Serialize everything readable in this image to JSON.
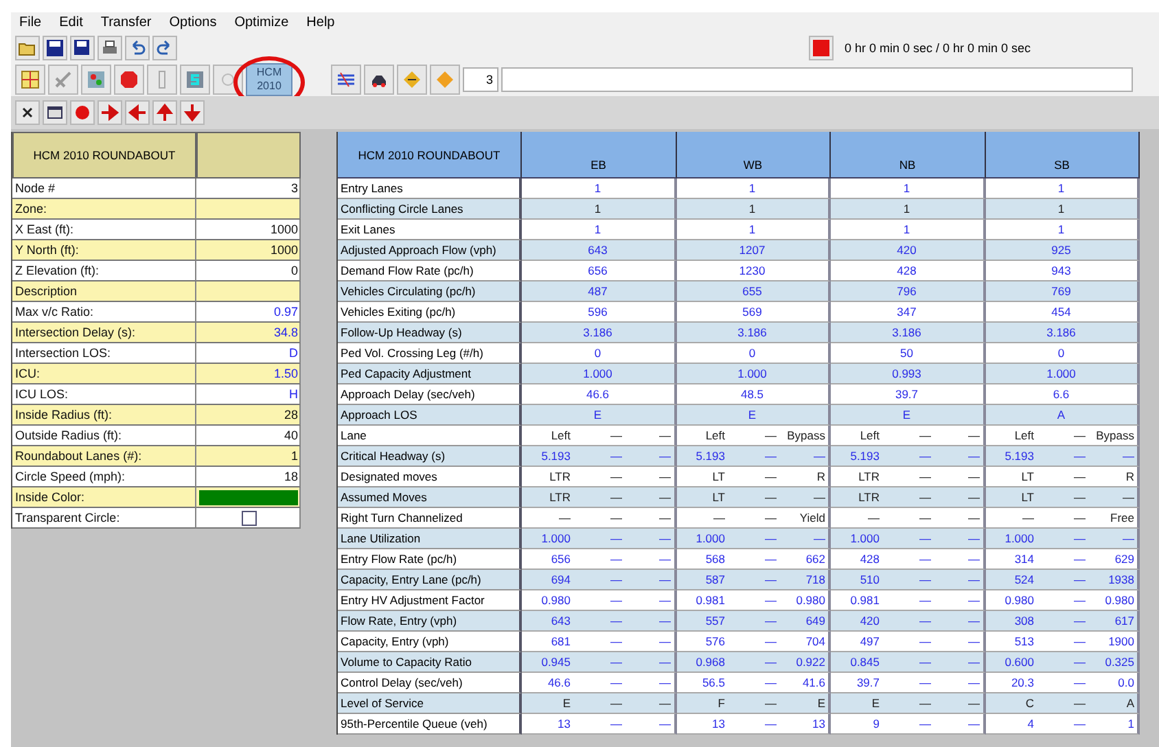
{
  "menu": [
    "File",
    "Edit",
    "Transfer",
    "Options",
    "Optimize",
    "Help"
  ],
  "toolbar": {
    "timer": "0 hr 0 min 0 sec /  0 hr 0 min 0 sec",
    "hcm_button": [
      "HCM",
      "2010"
    ],
    "node_field": "3"
  },
  "node_panel": {
    "title": "HCM 2010 ROUNDABOUT",
    "rows": [
      {
        "label": "Node #",
        "kind": "input",
        "value": "3"
      },
      {
        "label": "Zone:",
        "kind": "input"
      },
      {
        "label": "X East (ft):",
        "kind": "input",
        "value": "1000"
      },
      {
        "label": "Y North (ft):",
        "kind": "input",
        "value": "1000"
      },
      {
        "label": "Z Elevation (ft):",
        "kind": "input",
        "value": "0"
      },
      {
        "label": "Description",
        "kind": "input"
      },
      {
        "label": "Max v/c Ratio:",
        "kind": "output",
        "value": "0.97"
      },
      {
        "label": "Intersection Delay (s):",
        "kind": "output",
        "value": "34.8"
      },
      {
        "label": "Intersection LOS:",
        "kind": "output",
        "value": "D"
      },
      {
        "label": "ICU:",
        "kind": "output",
        "value": "1.50"
      },
      {
        "label": "ICU LOS:",
        "kind": "output",
        "value": "H"
      },
      {
        "label": "Inside Radius (ft):",
        "kind": "input",
        "value": "28"
      },
      {
        "label": "Outside Radius (ft):",
        "kind": "input",
        "value": "40"
      },
      {
        "label": "Roundabout Lanes (#):",
        "kind": "input",
        "value": "1"
      },
      {
        "label": "Circle Speed (mph):",
        "kind": "input",
        "value": "18"
      },
      {
        "label": "Inside Color:",
        "kind": "color",
        "color": "#008000"
      },
      {
        "label": "Transparent Circle:",
        "kind": "checkbox",
        "checked": false
      }
    ]
  },
  "results_table": {
    "title": "HCM 2010 ROUNDABOUT",
    "approaches": [
      "EB",
      "WB",
      "NB",
      "SB"
    ],
    "summary_rows": [
      {
        "label": "Entry Lanes",
        "kind": "output",
        "values": [
          "1",
          "1",
          "1",
          "1"
        ]
      },
      {
        "label": "Conflicting Circle Lanes",
        "kind": "input",
        "values": [
          "1",
          "1",
          "1",
          "1"
        ]
      },
      {
        "label": "Exit Lanes",
        "kind": "output",
        "values": [
          "1",
          "1",
          "1",
          "1"
        ]
      },
      {
        "label": "Adjusted Approach Flow (vph)",
        "kind": "output",
        "values": [
          "643",
          "1207",
          "420",
          "925"
        ]
      },
      {
        "label": "Demand Flow Rate (pc/h)",
        "kind": "output",
        "values": [
          "656",
          "1230",
          "428",
          "943"
        ]
      },
      {
        "label": "Vehicles Circulating (pc/h)",
        "kind": "output",
        "values": [
          "487",
          "655",
          "796",
          "769"
        ]
      },
      {
        "label": "Vehicles Exiting (pc/h)",
        "kind": "output",
        "values": [
          "596",
          "569",
          "347",
          "454"
        ]
      },
      {
        "label": "Follow-Up Headway (s)",
        "kind": "output",
        "values": [
          "3.186",
          "3.186",
          "3.186",
          "3.186"
        ]
      },
      {
        "label": "Ped Vol. Crossing Leg (#/h)",
        "kind": "output",
        "values": [
          "0",
          "0",
          "50",
          "0"
        ]
      },
      {
        "label": "Ped Capacity Adjustment",
        "kind": "output",
        "values": [
          "1.000",
          "1.000",
          "0.993",
          "1.000"
        ]
      },
      {
        "label": "Approach Delay (sec/veh)",
        "kind": "output",
        "values": [
          "46.6",
          "48.5",
          "39.7",
          "6.6"
        ]
      },
      {
        "label": "Approach LOS",
        "kind": "output",
        "values": [
          "E",
          "E",
          "E",
          "A"
        ]
      }
    ],
    "lane_rows": [
      {
        "label": "Lane",
        "kind": "input",
        "cells": [
          "Left",
          "—",
          "—",
          "Left",
          "—",
          "Bypass",
          "Left",
          "—",
          "—",
          "Left",
          "—",
          "Bypass"
        ]
      },
      {
        "label": "Critical Headway (s)",
        "kind": "output",
        "cells": [
          "5.193",
          "—",
          "—",
          "5.193",
          "—",
          "—",
          "5.193",
          "—",
          "—",
          "5.193",
          "—",
          "—"
        ]
      },
      {
        "label": "Designated moves",
        "kind": "input",
        "cells": [
          "LTR",
          "—",
          "—",
          "LT",
          "—",
          "R",
          "LTR",
          "—",
          "—",
          "LT",
          "—",
          "R"
        ]
      },
      {
        "label": "Assumed Moves",
        "kind": "input",
        "cells": [
          "LTR",
          "—",
          "—",
          "LT",
          "—",
          "—",
          "LTR",
          "—",
          "—",
          "LT",
          "—",
          "—"
        ]
      },
      {
        "label": "Right Turn Channelized",
        "kind": "input",
        "cells": [
          "—",
          "—",
          "—",
          "—",
          "—",
          "Yield",
          "—",
          "—",
          "—",
          "—",
          "—",
          "Free"
        ]
      },
      {
        "label": "Lane Utilization",
        "kind": "output",
        "cells": [
          "1.000",
          "—",
          "—",
          "1.000",
          "—",
          "—",
          "1.000",
          "—",
          "—",
          "1.000",
          "—",
          "—"
        ]
      },
      {
        "label": "Entry Flow Rate (pc/h)",
        "kind": "output",
        "cells": [
          "656",
          "—",
          "—",
          "568",
          "—",
          "662",
          "428",
          "—",
          "—",
          "314",
          "—",
          "629"
        ]
      },
      {
        "label": "Capacity, Entry Lane (pc/h)",
        "kind": "output",
        "cells": [
          "694",
          "—",
          "—",
          "587",
          "—",
          "718",
          "510",
          "—",
          "—",
          "524",
          "—",
          "1938"
        ]
      },
      {
        "label": "Entry HV Adjustment Factor",
        "kind": "output",
        "cells": [
          "0.980",
          "—",
          "—",
          "0.981",
          "—",
          "0.980",
          "0.981",
          "—",
          "—",
          "0.980",
          "—",
          "0.980"
        ]
      },
      {
        "label": "Flow Rate, Entry (vph)",
        "kind": "output",
        "cells": [
          "643",
          "—",
          "—",
          "557",
          "—",
          "649",
          "420",
          "—",
          "—",
          "308",
          "—",
          "617"
        ]
      },
      {
        "label": "Capacity, Entry (vph)",
        "kind": "output",
        "cells": [
          "681",
          "—",
          "—",
          "576",
          "—",
          "704",
          "497",
          "—",
          "—",
          "513",
          "—",
          "1900"
        ]
      },
      {
        "label": "Volume to Capacity Ratio",
        "kind": "output",
        "cells": [
          "0.945",
          "—",
          "—",
          "0.968",
          "—",
          "0.922",
          "0.845",
          "—",
          "—",
          "0.600",
          "—",
          "0.325"
        ]
      },
      {
        "label": "Control Delay (sec/veh)",
        "kind": "output",
        "cells": [
          "46.6",
          "—",
          "—",
          "56.5",
          "—",
          "41.6",
          "39.7",
          "—",
          "—",
          "20.3",
          "—",
          "0.0"
        ]
      },
      {
        "label": "Level of Service",
        "kind": "input",
        "cells": [
          "E",
          "—",
          "—",
          "F",
          "—",
          "E",
          "E",
          "—",
          "—",
          "C",
          "—",
          "A"
        ]
      },
      {
        "label": "95th-Percentile Queue (veh)",
        "kind": "output",
        "cells": [
          "13",
          "—",
          "—",
          "13",
          "—",
          "13",
          "9",
          "—",
          "—",
          "4",
          "—",
          "1"
        ]
      }
    ]
  }
}
